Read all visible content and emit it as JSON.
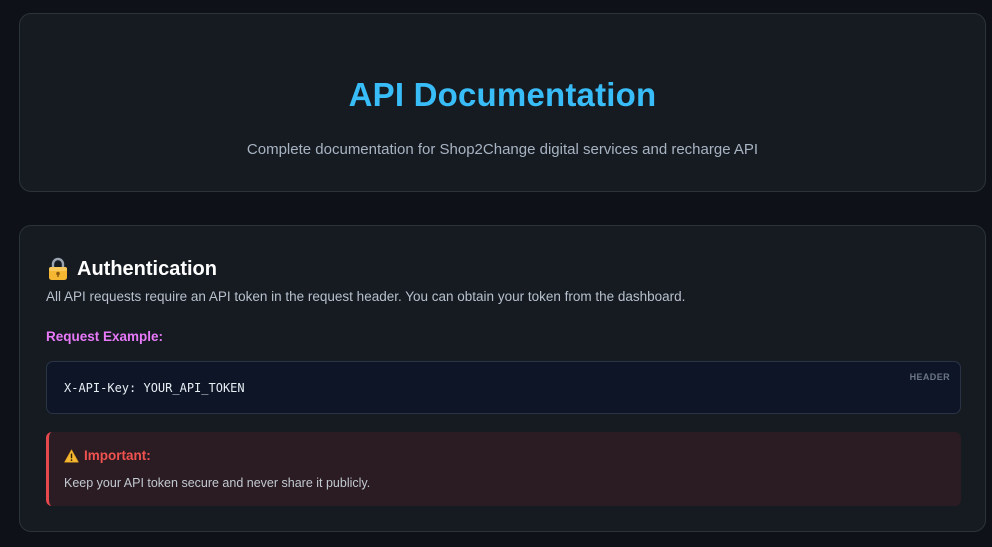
{
  "hero": {
    "title": "API Documentation",
    "subtitle": "Complete documentation for Shop2Change digital services and recharge API"
  },
  "auth": {
    "icon": "lock-icon",
    "title": "Authentication",
    "description": "All API requests require an API token in the request header. You can obtain your token from the dashboard.",
    "request_label": "Request Example:",
    "code": "X-API-Key: YOUR_API_TOKEN",
    "code_tag": "HEADER",
    "alert": {
      "icon": "warning-icon",
      "title": "Important:",
      "text": "Keep your API token secure and never share it publicly."
    }
  },
  "colors": {
    "background": "#0e1117",
    "card": "#161b22",
    "accent": "#38bdf8",
    "request_label": "#e879f9",
    "alert_red": "#f0524f"
  }
}
